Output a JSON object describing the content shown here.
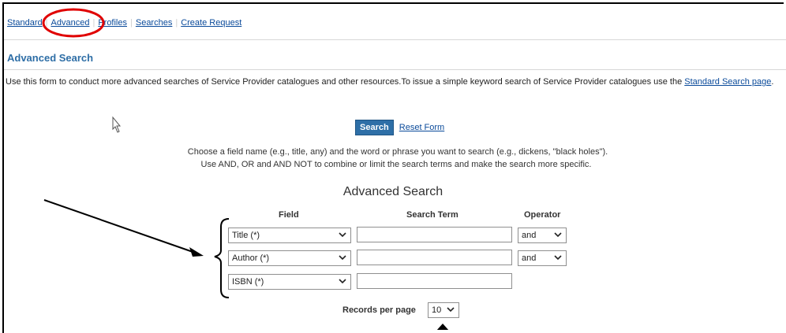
{
  "topnav": {
    "standard": "Standard",
    "advanced": "Advanced",
    "profiles": "Profiles",
    "searches": "Searches",
    "create_request": "Create Request"
  },
  "page_title": "Advanced Search",
  "intro": {
    "text": "Use this form to conduct more advanced searches of Service Provider catalogues and other resources.To issue a simple keyword search of Service Provider catalogues use the ",
    "link": "Standard Search page",
    "end": "."
  },
  "actions": {
    "search": "Search",
    "reset": "Reset Form"
  },
  "instructions": {
    "line1": "Choose a field name (e.g., title, any) and the word or phrase you want to search (e.g., dickens, \"black holes\").",
    "line2": "Use AND, OR and AND NOT to combine or limit the search terms and make the search more specific."
  },
  "form": {
    "title": "Advanced Search",
    "headers": {
      "field": "Field",
      "term": "Search Term",
      "operator": "Operator"
    },
    "rows": [
      {
        "field": "Title (*)",
        "term": "",
        "operator": "and"
      },
      {
        "field": "Author (*)",
        "term": "",
        "operator": "and"
      },
      {
        "field": "ISBN (*)",
        "term": ""
      }
    ],
    "records_label": "Records per page",
    "records_value": "10"
  },
  "colors": {
    "link": "#0a4a9a",
    "title": "#2e6ea6",
    "button": "#2e6fa7",
    "annotation_red": "#e00000"
  }
}
